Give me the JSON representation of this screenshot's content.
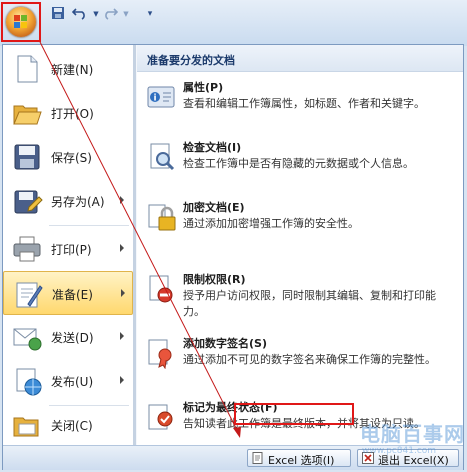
{
  "menu": {
    "left_items": [
      {
        "label": "新建(N)",
        "icon": "new-document-icon",
        "submenu": false
      },
      {
        "label": "打开(O)",
        "icon": "open-folder-icon",
        "submenu": false
      },
      {
        "label": "保存(S)",
        "icon": "save-disk-icon",
        "submenu": false
      },
      {
        "label": "另存为(A)",
        "icon": "save-as-icon",
        "submenu": true
      },
      {
        "label": "打印(P)",
        "icon": "printer-icon",
        "submenu": true
      },
      {
        "label": "准备(E)",
        "icon": "prepare-icon",
        "submenu": true,
        "active": true
      },
      {
        "label": "发送(D)",
        "icon": "send-icon",
        "submenu": true
      },
      {
        "label": "发布(U)",
        "icon": "publish-icon",
        "submenu": true
      },
      {
        "label": "关闭(C)",
        "icon": "close-folder-icon",
        "submenu": false
      }
    ],
    "right_header": "准备要分发的文档",
    "right_items": [
      {
        "title": "属性(P)",
        "desc": "查看和编辑工作簿属性，如标题、作者和关键字。",
        "icon": "properties-icon"
      },
      {
        "title": "检查文档(I)",
        "desc": "检查工作簿中是否有隐藏的元数据或个人信息。",
        "icon": "inspect-document-icon"
      },
      {
        "title": "加密文档(E)",
        "desc": "通过添加加密增强工作簿的安全性。",
        "icon": "encrypt-lock-icon"
      },
      {
        "title": "限制权限(R)",
        "desc": "授予用户访问权限，同时限制其编辑、复制和打印能力。",
        "icon": "restrict-permission-icon"
      },
      {
        "title": "添加数字签名(S)",
        "desc": "通过添加不可见的数字签名来确保工作簿的完整性。",
        "icon": "digital-signature-icon"
      },
      {
        "title": "标记为最终状态(F)",
        "desc": "告知读者此工作簿是最终版本，并将其设为只读。",
        "icon": "mark-final-icon"
      }
    ],
    "bottom": {
      "options_label": "Excel 选项(I)",
      "exit_label": "退出 Excel(X)"
    }
  },
  "watermark": {
    "text": "电脑百事网",
    "sub": "www.pc841.com"
  },
  "colors": {
    "highlight": "#e01818",
    "accent": "#1b3a6b",
    "active_bg": "#ffd86e"
  }
}
